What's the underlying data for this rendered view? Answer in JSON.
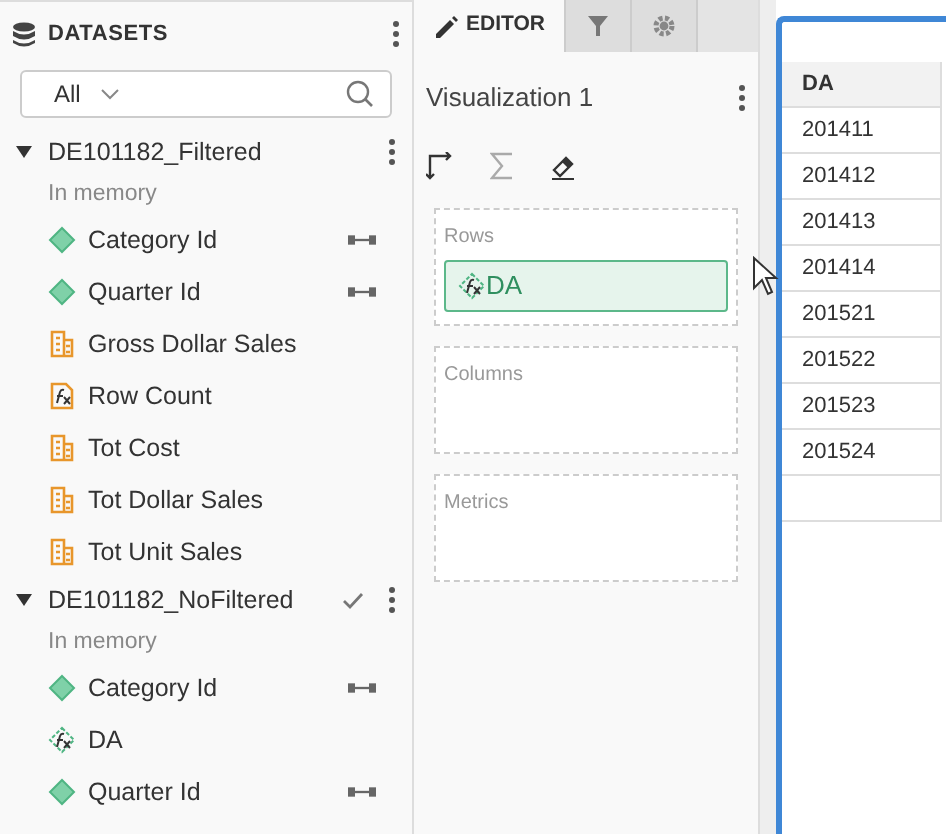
{
  "datasets_panel": {
    "title": "DATASETS",
    "filter": {
      "value": "All"
    },
    "datasets": [
      {
        "name": "DE101182_Filtered",
        "checked": false,
        "status": "In memory",
        "items": [
          {
            "name": "Category Id",
            "kind": "attribute",
            "linked": true
          },
          {
            "name": "Quarter Id",
            "kind": "attribute",
            "linked": true
          },
          {
            "name": "Gross Dollar Sales",
            "kind": "metric",
            "linked": false
          },
          {
            "name": "Row Count",
            "kind": "derived-metric",
            "linked": false
          },
          {
            "name": "Tot Cost",
            "kind": "metric",
            "linked": false
          },
          {
            "name": "Tot Dollar Sales",
            "kind": "metric",
            "linked": false
          },
          {
            "name": "Tot Unit Sales",
            "kind": "metric",
            "linked": false
          }
        ]
      },
      {
        "name": "DE101182_NoFiltered",
        "checked": true,
        "status": "In memory",
        "items": [
          {
            "name": "Category Id",
            "kind": "attribute",
            "linked": true
          },
          {
            "name": "DA",
            "kind": "derived-attribute",
            "linked": false
          },
          {
            "name": "Quarter Id",
            "kind": "attribute",
            "linked": true
          }
        ]
      }
    ]
  },
  "editor": {
    "tabs": [
      {
        "label": "EDITOR",
        "selected": true
      },
      {
        "selected": false
      },
      {
        "selected": false
      }
    ],
    "title": "Visualization 1",
    "zones": [
      {
        "label": "Rows",
        "items": [
          {
            "name": "DA",
            "kind": "derived-attribute"
          }
        ]
      },
      {
        "label": "Columns"
      },
      {
        "label": "Metrics"
      }
    ]
  },
  "grid": {
    "columns": [
      "DA"
    ],
    "rows": [
      "201411",
      "201412",
      "201413",
      "201414",
      "201521",
      "201522",
      "201523",
      "201524"
    ]
  }
}
